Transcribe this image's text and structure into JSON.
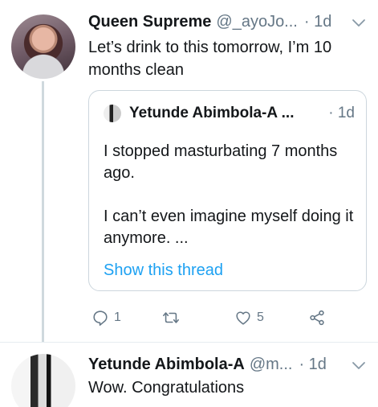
{
  "tweet1": {
    "name": "Queen Supreme",
    "handle": "@_ayoJo...",
    "time": "· 1d",
    "text": "Let’s drink to this tomorrow, I’m 10 months clean",
    "quote": {
      "name": "Yetunde Abimbola-A ...",
      "time": "· 1d",
      "paragraph1": "I stopped masturbating 7 months ago.",
      "paragraph2": "I can’t even imagine myself doing it anymore. ...",
      "link": "Show this thread"
    },
    "actions": {
      "reply_count": "1",
      "retweet_count": "",
      "like_count": "5"
    }
  },
  "tweet2": {
    "name": "Yetunde Abimbola-A",
    "handle": "@m...",
    "time": "· 1d",
    "text": "Wow. Congratulations"
  },
  "icons": {
    "reply": "reply-icon",
    "retweet": "retweet-icon",
    "like": "heart-icon",
    "share": "share-icon",
    "menu": "chevron-down-icon"
  },
  "colors": {
    "link": "#1da1f2",
    "muted": "#657786",
    "text": "#14171a"
  }
}
